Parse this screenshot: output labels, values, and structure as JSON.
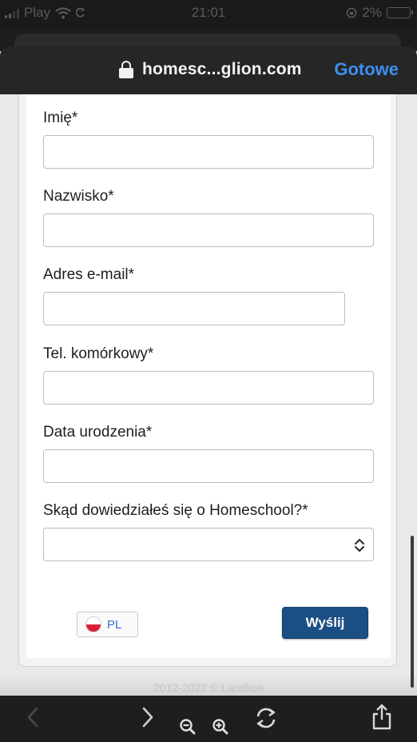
{
  "status_bar": {
    "carrier": "Play",
    "time": "21:01",
    "battery": "2%"
  },
  "browser": {
    "url": "homesc...glion.com",
    "done_label": "Gotowe"
  },
  "form": {
    "fields": [
      {
        "label": "Imię*",
        "value": ""
      },
      {
        "label": "Nazwisko*",
        "value": ""
      },
      {
        "label": "Adres e-mail*",
        "value": ""
      },
      {
        "label": "Tel. komórkowy*",
        "value": ""
      },
      {
        "label": "Data urodzenia*",
        "value": ""
      }
    ],
    "source_select": {
      "label": "Skąd dowiedziałeś się o Homeschool?*",
      "value": ""
    },
    "language_label": "PL",
    "submit_label": "Wyślij"
  },
  "footer": {
    "copyright": "2012-2022 © Landlion"
  },
  "colors": {
    "accent_link": "#3e8df0",
    "submit_bg": "#1b4f84",
    "flag_red": "#d9203a"
  },
  "icons": [
    "signal-icon",
    "wifi-icon",
    "lock-icon",
    "chevrons-icon",
    "flag-icon",
    "back-icon",
    "forward-icon",
    "zoom-out-icon",
    "zoom-in-icon",
    "reload-icon",
    "share-icon"
  ]
}
